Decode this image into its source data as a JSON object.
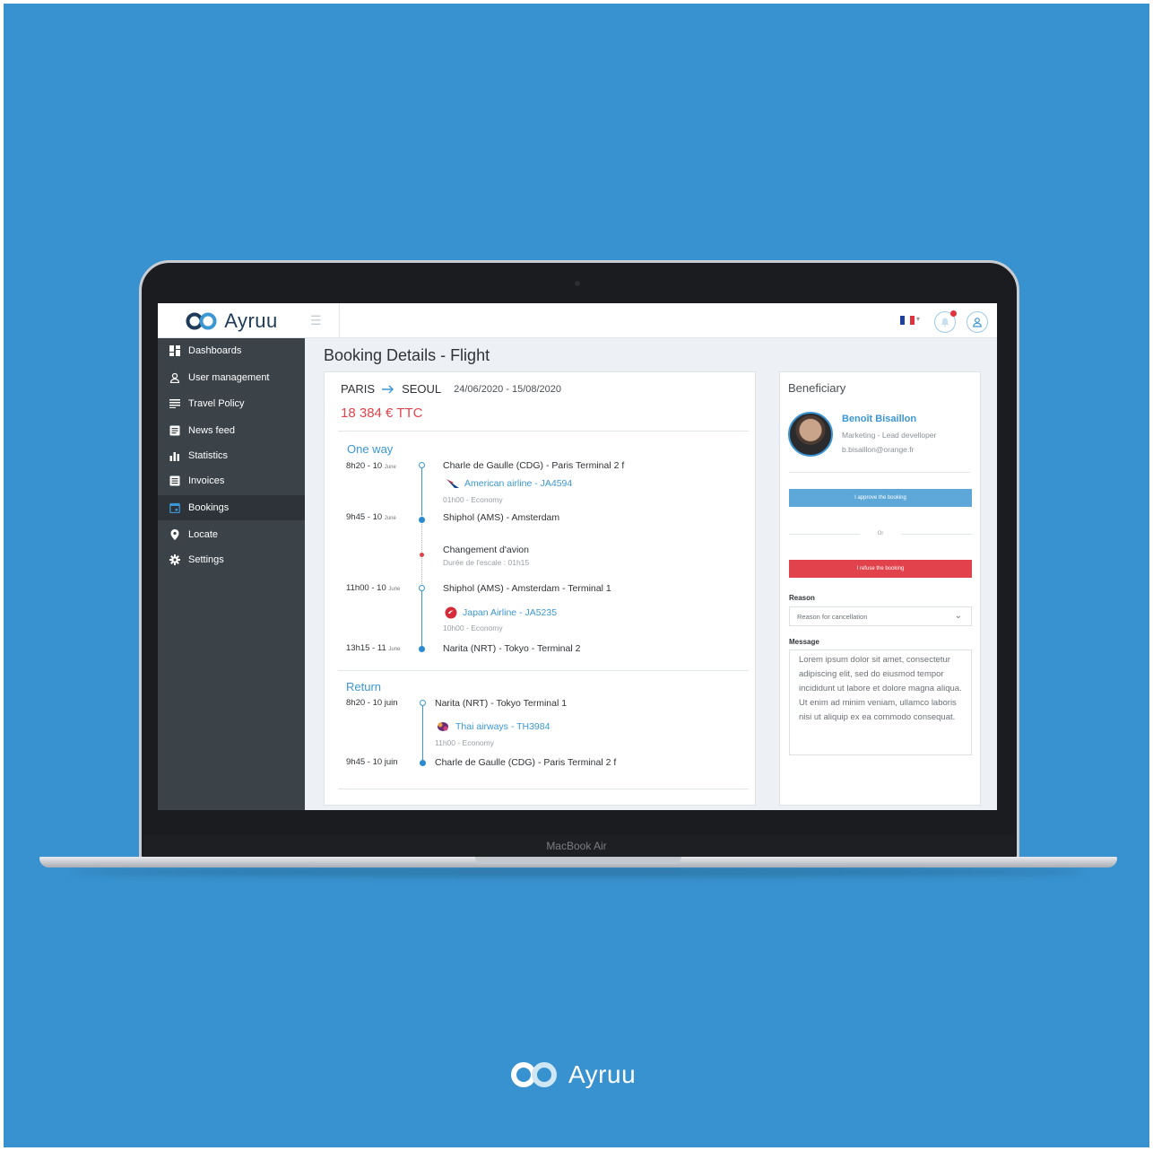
{
  "brand": {
    "name": "Ayruu",
    "colors": {
      "background": "#3892cf",
      "accent": "#3b97d3",
      "danger": "#e0444b",
      "sidebar": "#3b4349"
    }
  },
  "device": {
    "label": "MacBook Air"
  },
  "sidebar": {
    "items": [
      {
        "label": "Dashboards",
        "icon": "dashboard-icon"
      },
      {
        "label": "User management",
        "icon": "user-icon"
      },
      {
        "label": "Travel Policy",
        "icon": "list-icon"
      },
      {
        "label": "News feed",
        "icon": "newspaper-icon"
      },
      {
        "label": "Statistics",
        "icon": "bar-chart-icon"
      },
      {
        "label": "Invoices",
        "icon": "invoice-icon"
      },
      {
        "label": "Bookings",
        "icon": "calendar-icon",
        "active": true
      },
      {
        "label": "Locate",
        "icon": "map-pin-icon"
      },
      {
        "label": "Settings",
        "icon": "gear-icon"
      }
    ]
  },
  "page": {
    "title": "Booking Details - Flight"
  },
  "booking": {
    "from": "PARIS",
    "to": "SEOUL",
    "dates": "24/06/2020 - 15/08/2020",
    "price": "18 384 € TTC",
    "one_way": {
      "title": "One way",
      "legs": [
        {
          "time": "8h20 - 10",
          "month": "June",
          "stop": "Charle de Gaulle (CDG) - Paris Terminal 2 f"
        },
        {
          "airline": "American airline - JA4594",
          "detail": "01h00 - Economy"
        },
        {
          "time": "9h45 - 10",
          "month": "June",
          "stop": "Shiphol (AMS) - Amsterdam"
        },
        {
          "stop": "Changement d'avion",
          "detail": "Durée de l'escale : 01h15"
        },
        {
          "time": "11h00 - 10",
          "month": "June",
          "stop": "Shiphol (AMS) - Amsterdam - Terminal 1"
        },
        {
          "airline": "Japan Airline - JA5235",
          "detail": "10h00 - Economy"
        },
        {
          "time": "13h15 - 11",
          "month": "June",
          "stop": "Narita (NRT) - Tokyo - Terminal 2"
        }
      ]
    },
    "return": {
      "title": "Return",
      "legs": [
        {
          "time": "8h20 - 10 juin",
          "stop": "Narita (NRT) - Tokyo Terminal 1"
        },
        {
          "airline": "Thai airways - TH3984",
          "detail": "11h00 - Economy"
        },
        {
          "time": "9h45 - 10 juin",
          "stop": "Charle de Gaulle (CDG) - Paris Terminal 2 f"
        }
      ]
    }
  },
  "beneficiary": {
    "title": "Beneficiary",
    "name": "Benoît Bisaillon",
    "role": "Marketing - Lead develloper",
    "email": "b.bisaillon@orange.fr",
    "approve_label": "I approve the booking",
    "or_label": "Or",
    "refuse_label": "I refuse the booking",
    "reason_label": "Reason",
    "reason_placeholder": "Reason for cancellation",
    "message_label": "Message",
    "message": "Lorem ipsum dolor sit amet, consectetur adipiscing elit, sed do eiusmod tempor incididunt ut labore et dolore magna aliqua. Ut enim ad minim veniam, ullamco laboris nisi ut aliquip ex ea commodo consequat."
  }
}
